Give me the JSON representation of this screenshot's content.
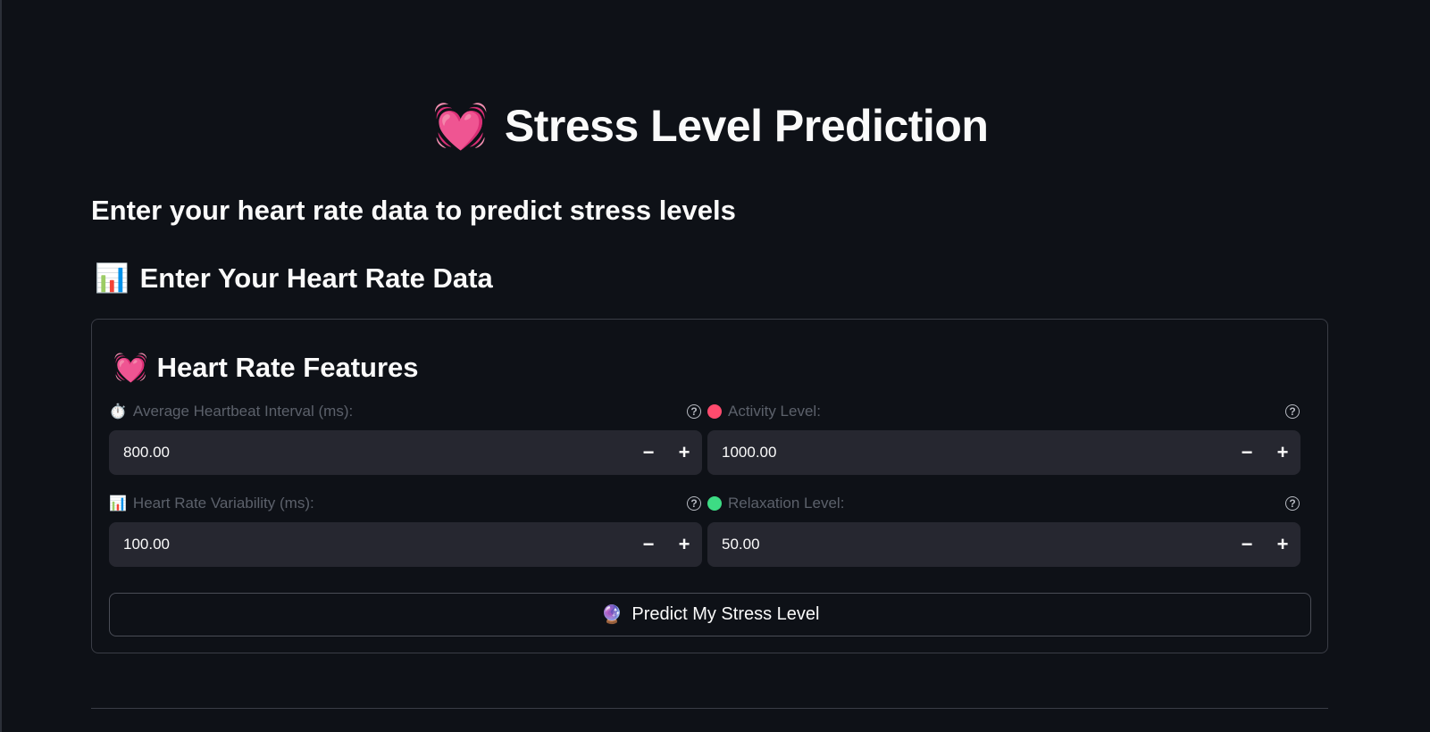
{
  "page": {
    "title_icon": "💓",
    "title": "Stress Level Prediction",
    "subtitle": "Enter your heart rate data to predict stress levels"
  },
  "section": {
    "icon": "📊",
    "heading": "Enter Your Heart Rate Data"
  },
  "card": {
    "icon": "💓",
    "title": "Heart Rate Features",
    "fields": [
      {
        "icon": "⏱️",
        "label": "Average Heartbeat Interval (ms):",
        "value": "800.00"
      },
      {
        "icon": "red-circle-icon",
        "label": "Activity Level:",
        "value": "1000.00"
      },
      {
        "icon": "📊",
        "label": "Heart Rate Variability (ms):",
        "value": "100.00"
      },
      {
        "icon": "green-circle-icon",
        "label": "Relaxation Level:",
        "value": "50.00"
      }
    ],
    "help_glyph": "?",
    "minus_glyph": "−",
    "plus_glyph": "+",
    "predict_button": {
      "icon": "🔮",
      "label": "Predict My Stress Level"
    }
  },
  "colors": {
    "background": "#0e1117",
    "input_bg": "#262730",
    "activity_dot": "#ff4b6e",
    "relaxation_dot": "#3ddc84"
  }
}
